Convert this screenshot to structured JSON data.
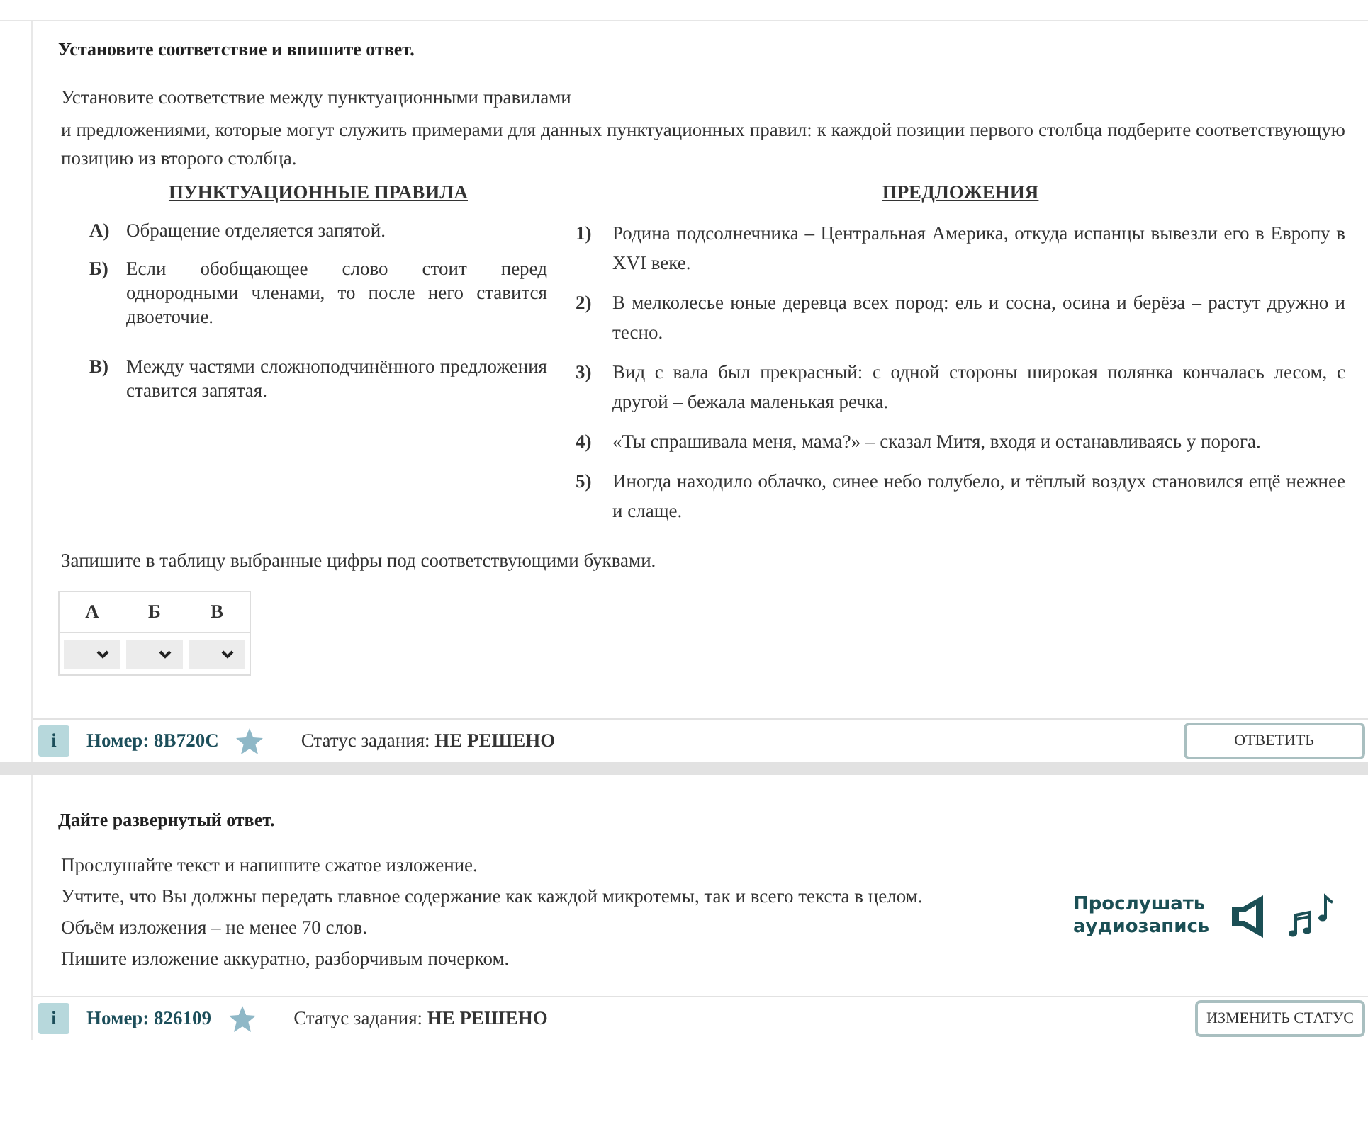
{
  "tasks": [
    {
      "kind": "matching",
      "heading": "Установите соответствие и впишите ответ.",
      "intro": [
        "Установите соответствие между пунктуационными правилами",
        "и предложениями, которые могут служить примерами для данных пунктуационных правил: к каждой позиции первого столбца подберите соответствующую позицию из второго столбца."
      ],
      "left_title": "ПУНКТУАЦИОННЫЕ ПРАВИЛА",
      "left_items": [
        {
          "mark": "А)",
          "text": "Обращение отделяется запятой."
        },
        {
          "mark": "Б)",
          "text": "Если обобщающее слово стоит перед однородными членами, то после него ставится двоеточие."
        },
        {
          "mark": "В)",
          "text": "Между частями сложноподчинённого предложения ставится запятая."
        }
      ],
      "right_title": "ПРЕДЛОЖЕНИЯ",
      "right_items": [
        {
          "mark": "1)",
          "text": "Родина подсолнечника – Центральная Америка, откуда испанцы вывезли его в Европу в XVI веке."
        },
        {
          "mark": "2)",
          "text": "В мелколесье юные деревца всех пород: ель и сосна, осина и берёза – растут дружно и тесно."
        },
        {
          "mark": "3)",
          "text": "Вид с вала был прекрасный: с одной стороны широкая полянка кончалась лесом, с другой – бежала маленькая речка."
        },
        {
          "mark": "4)",
          "text": "«Ты спрашивала меня, мама?» – сказал Митя, входя и останавливаясь у порога."
        },
        {
          "mark": "5)",
          "text": "Иногда находило облачко, синее небо голубело, и тёплый воздух становился ещё нежнее и слаще."
        }
      ],
      "table_prompt": "Запишите в таблицу выбранные цифры под соответствующими буквами.",
      "answer_columns": [
        "А",
        "Б",
        "В"
      ],
      "footer": {
        "info": "i",
        "number_label": "Номер:",
        "number": "8B720C",
        "status_label": "Статус задания:",
        "status": "НЕ РЕШЕНО",
        "button": "ОТВЕТИТЬ"
      }
    },
    {
      "kind": "essay",
      "heading": "Дайте развернутый ответ.",
      "paragraphs": [
        "Прослушайте текст и напишите сжатое изложение.",
        "Учтите, что Вы должны передать главное содержание как каждой микротемы, так и всего текста в целом.",
        "Объём изложения – не менее 70 слов.",
        "Пишите изложение аккуратно, разборчивым почерком."
      ],
      "audio_link": "Прослушать аудиозапись",
      "footer": {
        "info": "i",
        "number_label": "Номер:",
        "number": "826109",
        "status_label": "Статус задания:",
        "status": "НЕ РЕШЕНО",
        "button": "ИЗМЕНИТЬ СТАТУС"
      }
    }
  ]
}
